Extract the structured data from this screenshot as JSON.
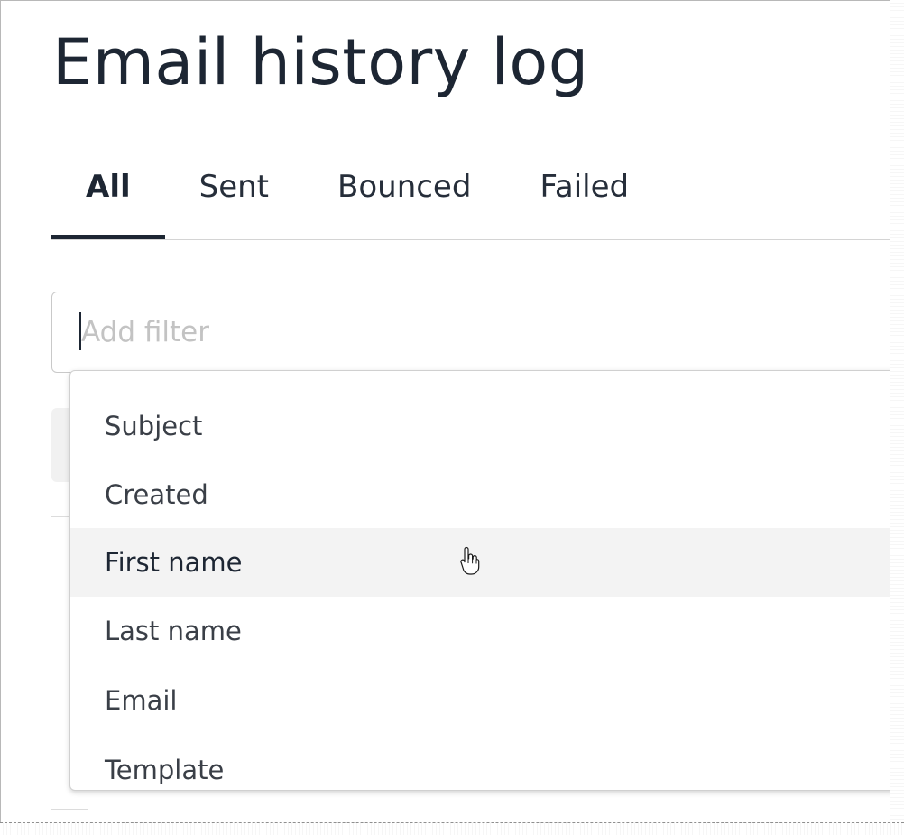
{
  "header": {
    "title": "Email history log"
  },
  "tabs": [
    {
      "label": "All",
      "active": true
    },
    {
      "label": "Sent",
      "active": false
    },
    {
      "label": "Bounced",
      "active": false
    },
    {
      "label": "Failed",
      "active": false
    }
  ],
  "filter": {
    "placeholder": "Add filter",
    "value": ""
  },
  "dropdown": {
    "options": [
      {
        "label": "Subject"
      },
      {
        "label": "Created"
      },
      {
        "label": "First name",
        "hovered": true
      },
      {
        "label": "Last name"
      },
      {
        "label": "Email"
      },
      {
        "label": "Template"
      }
    ]
  },
  "cursor": {
    "icon": "hand-pointer-icon"
  },
  "colors": {
    "text_dark": "#1d2633",
    "tab_indicator": "#1d2633",
    "placeholder": "#c3c3c3",
    "hover_row": "#f3f3f3",
    "border": "#c9c9c9"
  }
}
